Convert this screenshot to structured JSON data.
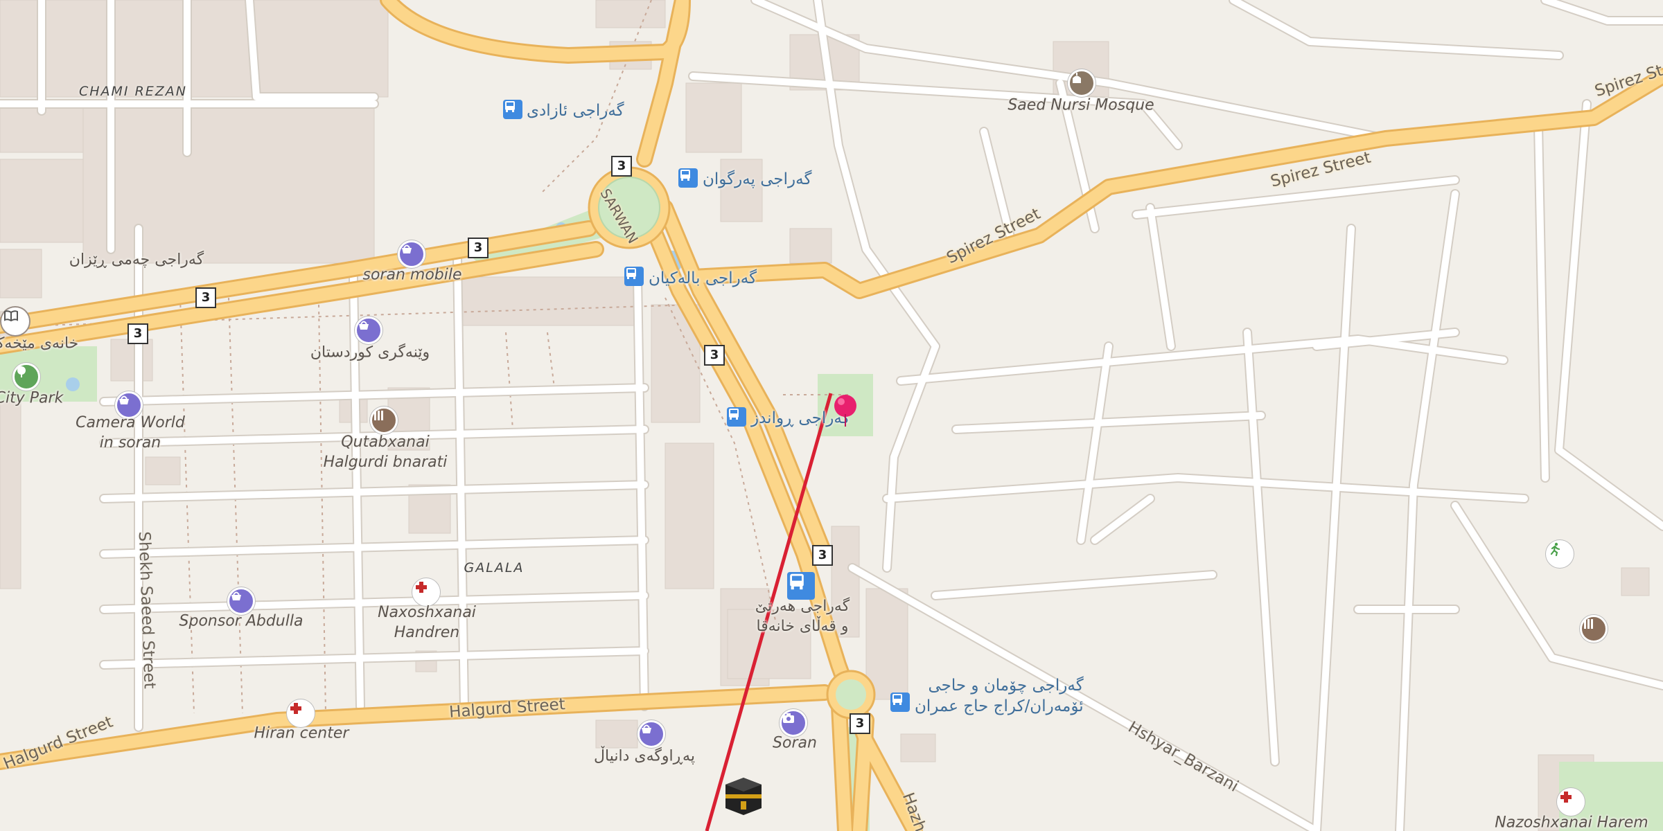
{
  "map": {
    "colors": {
      "background": "#f2efe9",
      "major_road": "#fcd68a",
      "major_road_casing": "#e8b25a",
      "minor_road": "#ffffff",
      "minor_road_casing": "#d4cdc4",
      "building": "#e6ddd6",
      "park": "#cfe8c4",
      "water": "#a9cfea",
      "route_line": "#d92033",
      "pin": "#e8206e"
    },
    "areas": [
      {
        "id": "chami-rezan",
        "label": "CHAMI REZAN"
      },
      {
        "id": "galala",
        "label": "GALALA"
      }
    ],
    "bus_stops": [
      {
        "id": "bus-azadi",
        "label": "گەراجی ئازادی"
      },
      {
        "id": "bus-harzgwan",
        "label": "گەراجی پەرگوان"
      },
      {
        "id": "bus-balakian",
        "label": "گەراجی بالەکیان"
      },
      {
        "id": "bus-rawanduz",
        "label": "گەراجی ڕواندز"
      },
      {
        "id": "bus-haji-omaran",
        "label_line1": "گەراجی چۆمان و حاجی",
        "label_line2": "ئۆمەران/كراج حاج عمران"
      },
      {
        "id": "bus-harir",
        "label_line1": "گەراجی هەرتێ",
        "label_line2": "و قەڵای خانەقا"
      }
    ],
    "pois": [
      {
        "id": "saed-nursi-mosque",
        "label": "Saed Nursi Mosque",
        "icon": "mosque-icon"
      },
      {
        "id": "soran-mobile",
        "label": "soran mobile",
        "icon": "shopping-basket-icon"
      },
      {
        "id": "chami-rezan-garage",
        "label": "گەراجی چەمی ڕێزان",
        "icon": "none"
      },
      {
        "id": "library",
        "label": "خانەی مێخەک",
        "icon": "book-icon"
      },
      {
        "id": "city-park",
        "label": "City Park",
        "icon": "tree-icon"
      },
      {
        "id": "kurdistan-shop",
        "label": "وێنەگری کوردستان",
        "icon": "shopping-basket-icon"
      },
      {
        "id": "camera-world",
        "label_line1": "Camera World",
        "label_line2": "in soran",
        "icon": "shopping-basket-icon"
      },
      {
        "id": "qutabxanai",
        "label_line1": "Qutabxanai",
        "label_line2": "Halgurdi bnarati",
        "icon": "library-icon"
      },
      {
        "id": "sponsor-abdulla",
        "label": "Sponsor Abdulla",
        "icon": "shopping-basket-icon"
      },
      {
        "id": "naxoshxanai-handren",
        "label_line1": "Naxoshxanai",
        "label_line2": "Handren",
        "icon": "hospital-cross-icon"
      },
      {
        "id": "hiran-center",
        "label": "Hiran center",
        "icon": "hospital-cross-icon"
      },
      {
        "id": "soran-photo",
        "label": "Soran",
        "icon": "camera-icon"
      },
      {
        "id": "parawgay-danyal",
        "label": "پەڕاوگەی دانیاڵ",
        "icon": "shopping-basket-icon"
      },
      {
        "id": "nazoshxanai-harem",
        "label": "Nazoshxanai Harem",
        "icon": "hospital-cross-icon"
      },
      {
        "id": "sports",
        "label": "",
        "icon": "running-person-icon"
      },
      {
        "id": "school",
        "label": "",
        "icon": "library-icon"
      },
      {
        "id": "kaaba",
        "label": "",
        "icon": "kaaba-icon"
      }
    ],
    "roads": [
      {
        "id": "spirez-street-1",
        "label": "Spirez Street"
      },
      {
        "id": "spirez-street-2",
        "label": "Spirez Street"
      },
      {
        "id": "spirez-street-3",
        "label": "Spirez St"
      },
      {
        "id": "halgurd-street-1",
        "label": "Halgurd Street"
      },
      {
        "id": "halgurd-street-2",
        "label": "Halgurd Street"
      },
      {
        "id": "shekh-saeed-street",
        "label": "Shekh Saeed Street"
      },
      {
        "id": "hshyar-barzani",
        "label": "Hshyar_Barzani"
      },
      {
        "id": "hazh",
        "label": "Hazh"
      },
      {
        "id": "sarwan",
        "label": "SARWAN"
      }
    ],
    "route_shields": [
      "3",
      "3",
      "3",
      "3",
      "3",
      "3",
      "3"
    ]
  }
}
